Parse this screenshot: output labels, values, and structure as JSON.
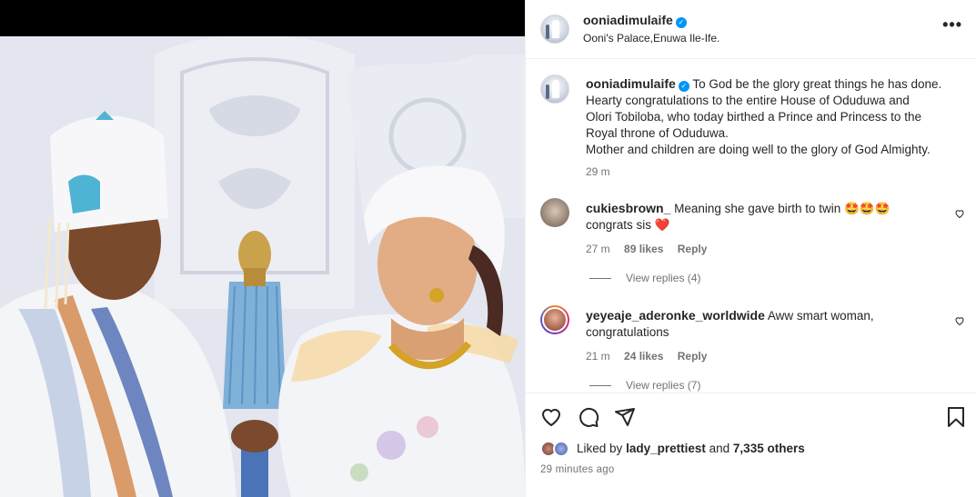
{
  "post": {
    "username": "ooniadimulaife",
    "verified_icon": "verified-badge-icon",
    "location": "Ooni's Palace,Enuwa Ile-Ife.",
    "more_icon": "more-options-icon"
  },
  "caption": {
    "username": "ooniadimulaife",
    "text_lines": [
      "To God be the glory great things he has done.",
      "Hearty congratulations to the entire House of Oduduwa and",
      "Olori Tobiloba, who today birthed a Prince and Princess to the",
      "Royal throne of Oduduwa.",
      "Mother and children are doing well to the glory of God Almighty."
    ],
    "time": "29 m"
  },
  "comments": [
    {
      "username": "cukiesbrown_",
      "text_line1": "Meaning she gave birth to twin 🤩🤩🤩",
      "text_line2": "congrats sis ❤️",
      "time": "27 m",
      "likes": "89 likes",
      "reply": "Reply",
      "view_replies": "View replies (4)"
    },
    {
      "username": "yeyeaje_aderonke_worldwide",
      "text_line1": "Aww smart woman,",
      "text_line2": "congratulations",
      "time": "21 m",
      "likes": "24 likes",
      "reply": "Reply",
      "view_replies": "View replies (7)"
    }
  ],
  "actions": {
    "like_icon": "heart-icon",
    "comment_icon": "comment-icon",
    "share_icon": "share-icon",
    "save_icon": "bookmark-icon"
  },
  "likes": {
    "prefix": "Liked by",
    "user": "lady_prettiest",
    "and": "and",
    "others": "7,335 others"
  },
  "posted_time": "29 minutes ago",
  "colors": {
    "text": "#262626",
    "secondary": "#737373",
    "verified": "#0095f6",
    "divider": "#efefef"
  }
}
